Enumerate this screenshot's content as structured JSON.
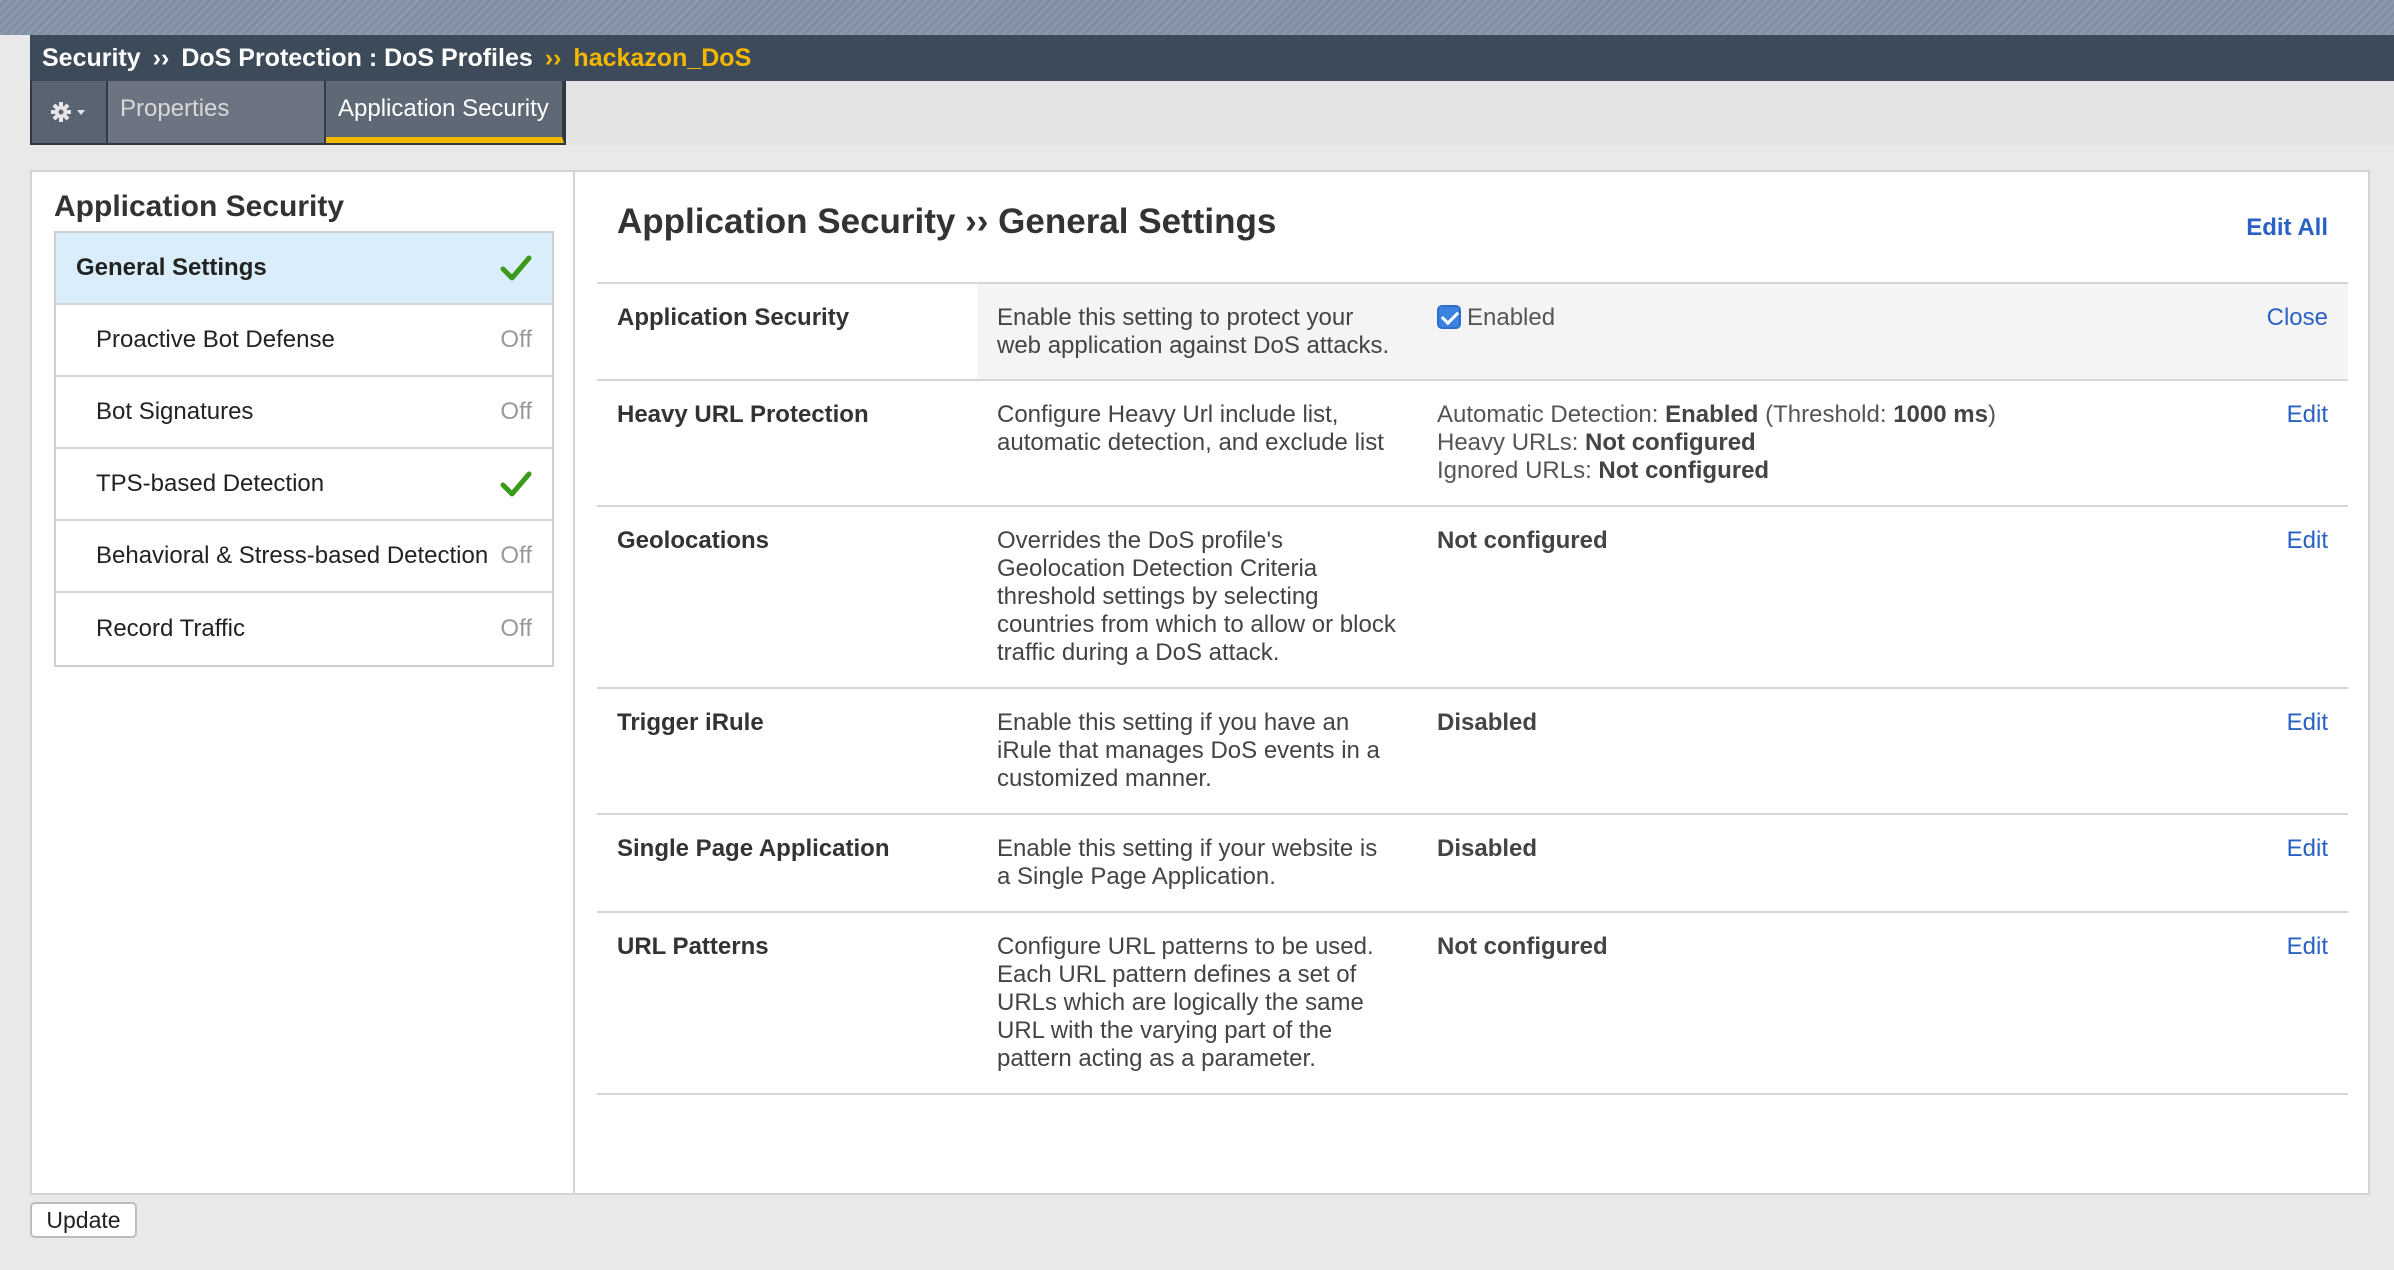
{
  "breadcrumb": {
    "item1": "Security",
    "sep": "››",
    "item2": "DoS Protection : DoS Profiles",
    "current": "hackazon_DoS"
  },
  "tabs": {
    "properties": "Properties",
    "application_security": "Application Security"
  },
  "sidebar": {
    "title": "Application Security",
    "items": [
      {
        "label": "General Settings",
        "status": "check"
      },
      {
        "label": "Proactive Bot Defense",
        "status": "Off"
      },
      {
        "label": "Bot Signatures",
        "status": "Off"
      },
      {
        "label": "TPS-based Detection",
        "status": "check"
      },
      {
        "label": "Behavioral & Stress-based Detection",
        "status": "Off"
      },
      {
        "label": "Record Traffic",
        "status": "Off"
      }
    ]
  },
  "main": {
    "title": "Application Security ›› General Settings",
    "edit_all": "Edit All",
    "rows": [
      {
        "label": "Application Security",
        "desc": [
          "Enable this setting to protect your",
          "web application against DoS attacks."
        ],
        "value_checkbox_label": "Enabled",
        "action": "Close"
      },
      {
        "label": "Heavy URL Protection",
        "desc": [
          "Configure Heavy Url include list,",
          "automatic detection, and exclude list"
        ],
        "value_lines": [
          {
            "prefix": "Automatic Detection: ",
            "bold": "Enabled",
            "mid": " (Threshold: ",
            "bold2": "1000 ms",
            "suffix": ")"
          },
          {
            "prefix": "Heavy URLs: ",
            "bold": "Not configured"
          },
          {
            "prefix": "Ignored URLs: ",
            "bold": "Not configured"
          }
        ],
        "action": "Edit"
      },
      {
        "label": "Geolocations",
        "desc": [
          "Overrides the DoS profile's",
          "Geolocation Detection Criteria",
          "threshold settings by selecting",
          "countries from which to allow or block",
          "traffic during a DoS attack."
        ],
        "value": "Not configured",
        "action": "Edit"
      },
      {
        "label": "Trigger iRule",
        "desc": [
          "Enable this setting if you have an",
          "iRule that manages DoS events in a",
          "customized manner."
        ],
        "value": "Disabled",
        "action": "Edit"
      },
      {
        "label": "Single Page Application",
        "desc": [
          "Enable this setting if your website is",
          "a Single Page Application."
        ],
        "value": "Disabled",
        "action": "Edit"
      },
      {
        "label": "URL Patterns",
        "desc": [
          "Configure URL patterns to be used.",
          "Each URL pattern defines a set of",
          "URLs which are logically the same",
          "URL with the varying part of the",
          "pattern acting as a parameter."
        ],
        "value": "Not configured",
        "action": "Edit"
      }
    ]
  },
  "footer": {
    "update_label": "Update"
  },
  "colors": {
    "accent_yellow": "#f5b800",
    "link_blue": "#2a62c4",
    "check_green": "#3a9a1a",
    "selected_bg": "#d9eefa"
  }
}
